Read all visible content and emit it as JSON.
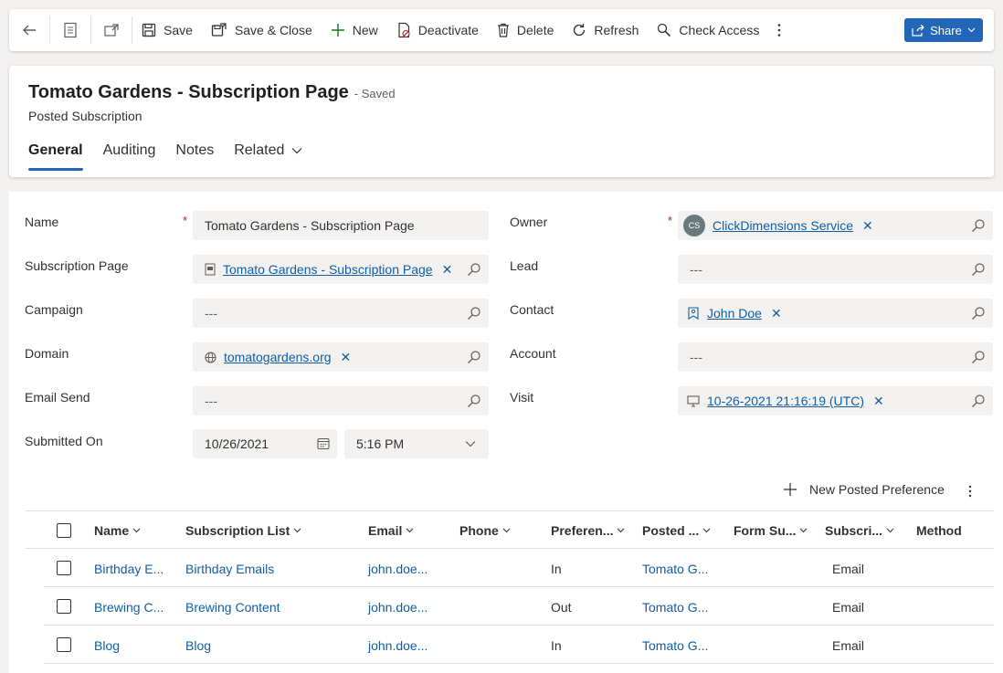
{
  "commandbar": {
    "save": "Save",
    "save_close": "Save & Close",
    "new": "New",
    "deactivate": "Deactivate",
    "delete": "Delete",
    "refresh": "Refresh",
    "check_access": "Check Access",
    "share": "Share"
  },
  "header": {
    "title": "Tomato Gardens - Subscription Page",
    "status": "- Saved",
    "entity": "Posted Subscription",
    "tabs": [
      "General",
      "Auditing",
      "Notes",
      "Related"
    ]
  },
  "form": {
    "name_label": "Name",
    "name_value": "Tomato Gardens - Subscription Page",
    "subscription_page_label": "Subscription Page",
    "subscription_page_value": "Tomato Gardens - Subscription Page",
    "campaign_label": "Campaign",
    "empty": "---",
    "domain_label": "Domain",
    "domain_value": "tomatogardens.org",
    "email_send_label": "Email Send",
    "submitted_on_label": "Submitted On",
    "submitted_date": "10/26/2021",
    "submitted_time": "5:16 PM",
    "owner_label": "Owner",
    "owner_initials": "CS",
    "owner_value": "ClickDimensions Service",
    "lead_label": "Lead",
    "contact_label": "Contact",
    "contact_value": "John Doe",
    "account_label": "Account",
    "visit_label": "Visit",
    "visit_value": "10-26-2021 21:16:19 (UTC)",
    "required_mark": "*",
    "remove_mark": "✕"
  },
  "grid": {
    "new_label": "New Posted Preference",
    "columns": [
      "Name",
      "Subscription List",
      "Email",
      "Phone",
      "Preferen...",
      "Posted ...",
      "Form Su...",
      "Subscri...",
      "Method"
    ],
    "rows": [
      {
        "name": "Birthday E...",
        "list": "Birthday Emails",
        "email": "john.doe...",
        "pref": "In",
        "posted": "Tomato G...",
        "method": "Email"
      },
      {
        "name": "Brewing C...",
        "list": "Brewing Content",
        "email": "john.doe...",
        "pref": "Out",
        "posted": "Tomato G...",
        "method": "Email"
      },
      {
        "name": "Blog",
        "list": "Blog",
        "email": "john.doe...",
        "pref": "In",
        "posted": "Tomato G...",
        "method": "Email"
      }
    ]
  },
  "colors": {
    "accent": "#2266b8",
    "link": "#115ea3",
    "required": "#a4262c"
  }
}
